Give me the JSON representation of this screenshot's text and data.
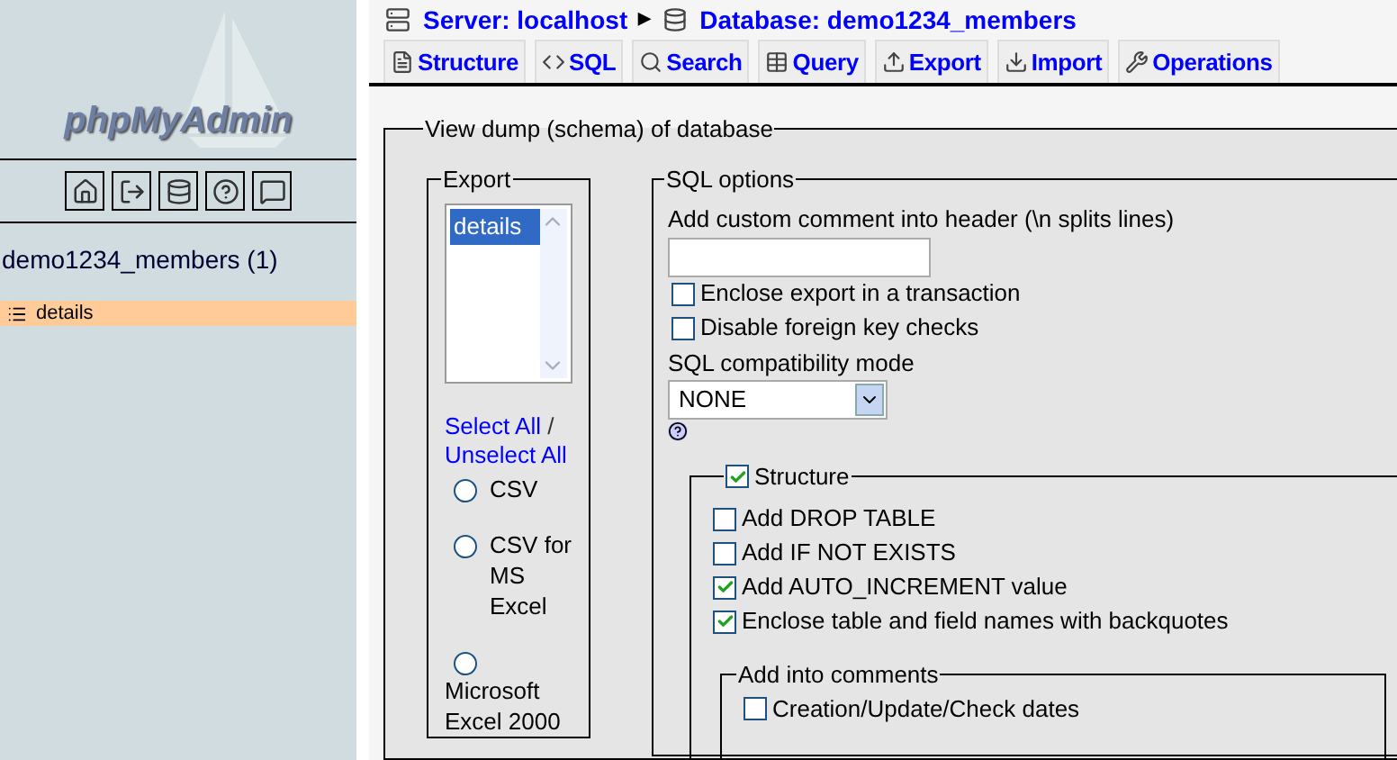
{
  "sidebar": {
    "logo": "phpMyAdmin",
    "database": "demo1234_members (1)",
    "tables": [
      {
        "name": "details",
        "selected": true
      }
    ]
  },
  "breadcrumb": [
    {
      "kind": "server",
      "label": "Server: localhost"
    },
    {
      "kind": "separator",
      "label": "▶"
    },
    {
      "kind": "database",
      "label": "Database: demo1234_members"
    }
  ],
  "tabs": [
    {
      "kind": "structure",
      "label": "Structure",
      "selected": false
    },
    {
      "kind": "sql",
      "label": "SQL",
      "selected": false
    },
    {
      "kind": "search",
      "label": "Search",
      "selected": false
    },
    {
      "kind": "query",
      "label": "Query",
      "selected": false
    },
    {
      "kind": "export",
      "label": "Export",
      "selected": false
    },
    {
      "kind": "import",
      "label": "Import",
      "selected": false
    },
    {
      "kind": "operations",
      "label": "Operations",
      "selected": false
    }
  ],
  "dump": {
    "legend": "View dump (schema) of database",
    "export": {
      "legend": "Export",
      "tables": [
        {
          "name": "details",
          "selected": true
        }
      ],
      "select_all": "Select All",
      "separator": "/",
      "unselect_all": "Unselect All",
      "formats": [
        {
          "label": "CSV",
          "selected": false
        },
        {
          "label": "CSV for MS Excel",
          "selected": false
        },
        {
          "label": "Microsoft Excel 2000",
          "selected": false
        }
      ]
    },
    "sql_options": {
      "legend": "SQL options",
      "comment_label": "Add custom comment into header (\\n splits lines)",
      "options": [
        {
          "label": "Enclose export in a transaction",
          "checked": false
        },
        {
          "label": "Disable foreign key checks",
          "checked": false
        }
      ],
      "compat_label": "SQL compatibility mode",
      "compat_value": "NONE",
      "structure": {
        "label": "Structure",
        "checked": true,
        "options": [
          {
            "label": "Add DROP TABLE",
            "checked": false
          },
          {
            "label": "Add IF NOT EXISTS",
            "checked": false
          },
          {
            "label": "Add AUTO_INCREMENT value",
            "checked": true
          },
          {
            "label": "Enclose table and field names with backquotes",
            "checked": true
          }
        ],
        "comments": {
          "legend": "Add into comments",
          "options": [
            {
              "label": "Creation/Update/Check dates",
              "checked": false
            }
          ]
        }
      }
    }
  }
}
